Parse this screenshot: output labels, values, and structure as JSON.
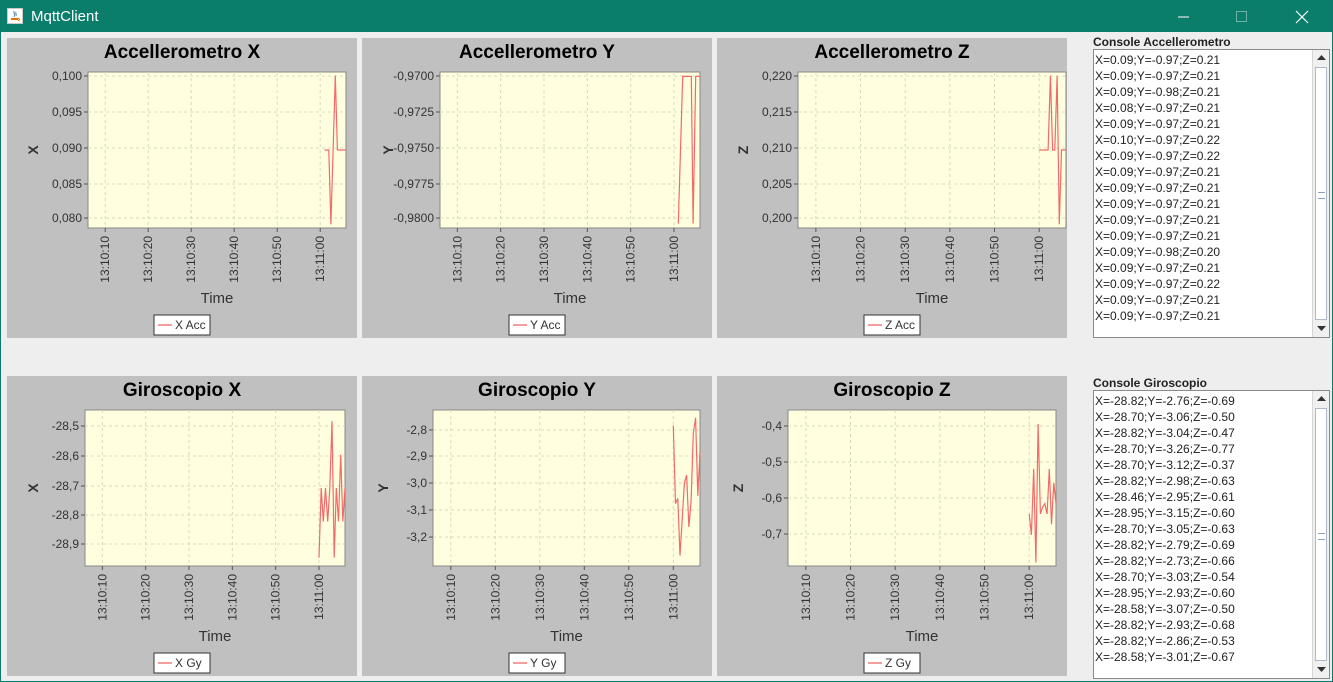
{
  "window": {
    "title": "MqttClient",
    "controls": {
      "minimize": "minimize-icon",
      "maximize": "maximize-icon",
      "close": "close-icon"
    }
  },
  "charts": [
    {
      "title": "Accellerometro X",
      "ylabel": "X",
      "xlabel": "Time",
      "legend": "X Acc",
      "yticks": [
        "0,100",
        "0,095",
        "0,090",
        "0,085",
        "0,080"
      ]
    },
    {
      "title": "Accellerometro Y",
      "ylabel": "Y",
      "xlabel": "Time",
      "legend": "Y Acc",
      "yticks": [
        "-0,9700",
        "-0,9725",
        "-0,9750",
        "-0,9775",
        "-0,9800"
      ]
    },
    {
      "title": "Accellerometro Z",
      "ylabel": "Z",
      "xlabel": "Time",
      "legend": "Z Acc",
      "yticks": [
        "0,220",
        "0,215",
        "0,210",
        "0,205",
        "0,200"
      ]
    },
    {
      "title": "Giroscopio X",
      "ylabel": "X",
      "xlabel": "Time",
      "legend": "X Gy",
      "yticks": [
        "-28,5",
        "-28,6",
        "-28,7",
        "-28,8",
        "-28,9"
      ]
    },
    {
      "title": "Giroscopio Y",
      "ylabel": "Y",
      "xlabel": "Time",
      "legend": "Y Gy",
      "yticks": [
        "-2,8",
        "-2,9",
        "-3,0",
        "-3,1",
        "-3,2"
      ]
    },
    {
      "title": "Giroscopio Z",
      "ylabel": "Z",
      "xlabel": "Time",
      "legend": "Z Gy",
      "yticks": [
        "-0,4",
        "-0,5",
        "-0,6",
        "-0,7"
      ]
    }
  ],
  "xticks": [
    "13:10:10",
    "13:10:20",
    "13:10:30",
    "13:10:40",
    "13:10:50",
    "13:11:00"
  ],
  "colors": {
    "plot_bg": "#ffffe0",
    "series": "#f26a6a",
    "panel": "#c0c0c0",
    "titlebar": "#0b7d6b"
  },
  "chart_data": [
    {
      "type": "line",
      "title": "Accellerometro X",
      "xlabel": "Time",
      "ylabel": "X",
      "x_range": [
        "13:10:06",
        "13:11:06"
      ],
      "ylim": [
        0.0795,
        0.1005
      ],
      "series": [
        {
          "name": "X Acc",
          "x": [
            "13:11:01",
            "13:11:02",
            "13:11:02.5",
            "13:11:03",
            "13:11:03.5",
            "13:11:04",
            "13:11:05",
            "13:11:06"
          ],
          "values": [
            0.09,
            0.09,
            0.08,
            0.09,
            0.1,
            0.09,
            0.09,
            0.09
          ]
        }
      ]
    },
    {
      "type": "line",
      "title": "Accellerometro Y",
      "xlabel": "Time",
      "ylabel": "Y",
      "x_range": [
        "13:10:06",
        "13:11:06"
      ],
      "ylim": [
        -0.9803,
        -0.9697
      ],
      "series": [
        {
          "name": "Y Acc",
          "x": [
            "13:11:01",
            "13:11:02",
            "13:11:02.4",
            "13:11:03",
            "13:11:04",
            "13:11:04.4",
            "13:11:05",
            "13:11:05.4",
            "13:11:06"
          ],
          "values": [
            -0.98,
            -0.97,
            -0.97,
            -0.97,
            -0.97,
            -0.98,
            -0.97,
            -0.97,
            -0.97
          ]
        }
      ]
    },
    {
      "type": "line",
      "title": "Accellerometro Z",
      "xlabel": "Time",
      "ylabel": "Z",
      "x_range": [
        "13:10:06",
        "13:11:06"
      ],
      "ylim": [
        0.1995,
        0.2205
      ],
      "series": [
        {
          "name": "Z Acc",
          "x": [
            "13:11:00",
            "13:11:01",
            "13:11:02",
            "13:11:02.5",
            "13:11:03",
            "13:11:03.5",
            "13:11:04",
            "13:11:04.5",
            "13:11:05",
            "13:11:05.5",
            "13:11:06"
          ],
          "values": [
            0.21,
            0.21,
            0.21,
            0.22,
            0.21,
            0.21,
            0.22,
            0.2,
            0.21,
            0.21,
            0.21
          ]
        }
      ]
    },
    {
      "type": "line",
      "title": "Giroscopio X",
      "xlabel": "Time",
      "ylabel": "X",
      "x_range": [
        "13:10:06",
        "13:11:06"
      ],
      "ylim": [
        -28.98,
        -28.42
      ],
      "series": [
        {
          "name": "X Gy",
          "x": [
            "13:11:00",
            "13:11:00.5",
            "13:11:01",
            "13:11:01.5",
            "13:11:02",
            "13:11:02.5",
            "13:11:03",
            "13:11:03.5",
            "13:11:04",
            "13:11:04.5",
            "13:11:05",
            "13:11:05.5",
            "13:11:06"
          ],
          "values": [
            -28.95,
            -28.7,
            -28.82,
            -28.7,
            -28.82,
            -28.7,
            -28.46,
            -28.95,
            -28.7,
            -28.82,
            -28.58,
            -28.82,
            -28.7
          ]
        }
      ]
    },
    {
      "type": "line",
      "title": "Giroscopio Y",
      "xlabel": "Time",
      "ylabel": "Y",
      "x_range": [
        "13:10:06",
        "13:11:06"
      ],
      "ylim": [
        -3.3,
        -2.7
      ],
      "series": [
        {
          "name": "Y Gy",
          "x": [
            "13:11:00",
            "13:11:00.5",
            "13:11:01",
            "13:11:01.5",
            "13:11:02",
            "13:11:02.5",
            "13:11:03",
            "13:11:03.5",
            "13:11:04",
            "13:11:04.5",
            "13:11:05",
            "13:11:05.5",
            "13:11:06"
          ],
          "values": [
            -2.76,
            -3.06,
            -3.04,
            -3.26,
            -3.12,
            -2.98,
            -2.95,
            -3.15,
            -3.05,
            -2.79,
            -2.73,
            -3.03,
            -2.86
          ]
        }
      ]
    },
    {
      "type": "line",
      "title": "Giroscopio Z",
      "xlabel": "Time",
      "ylabel": "Z",
      "x_range": [
        "13:10:06",
        "13:11:06"
      ],
      "ylim": [
        -0.78,
        -0.33
      ],
      "series": [
        {
          "name": "Z Gy",
          "x": [
            "13:11:00",
            "13:11:00.5",
            "13:11:01",
            "13:11:01.5",
            "13:11:02",
            "13:11:02.5",
            "13:11:03",
            "13:11:03.5",
            "13:11:04",
            "13:11:04.5",
            "13:11:05",
            "13:11:05.5",
            "13:11:06"
          ],
          "values": [
            -0.63,
            -0.69,
            -0.5,
            -0.77,
            -0.37,
            -0.63,
            -0.61,
            -0.6,
            -0.63,
            -0.5,
            -0.66,
            -0.54,
            -0.6
          ]
        }
      ]
    }
  ],
  "consoles": {
    "accel": {
      "label": "Console Accellerometro",
      "lines": [
        "X=0.09;Y=-0.97;Z=0.21",
        "X=0.09;Y=-0.97;Z=0.21",
        "X=0.09;Y=-0.98;Z=0.21",
        "X=0.08;Y=-0.97;Z=0.21",
        "X=0.09;Y=-0.97;Z=0.21",
        "X=0.10;Y=-0.97;Z=0.22",
        "X=0.09;Y=-0.97;Z=0.22",
        "X=0.09;Y=-0.97;Z=0.21",
        "X=0.09;Y=-0.97;Z=0.21",
        "X=0.09;Y=-0.97;Z=0.21",
        "X=0.09;Y=-0.97;Z=0.21",
        "X=0.09;Y=-0.97;Z=0.21",
        "X=0.09;Y=-0.98;Z=0.20",
        "X=0.09;Y=-0.97;Z=0.21",
        "X=0.09;Y=-0.97;Z=0.22",
        "X=0.09;Y=-0.97;Z=0.21",
        "X=0.09;Y=-0.97;Z=0.21"
      ]
    },
    "gyro": {
      "label": "Console Giroscopio",
      "lines": [
        "X=-28.82;Y=-2.76;Z=-0.69",
        "X=-28.70;Y=-3.06;Z=-0.50",
        "X=-28.82;Y=-3.04;Z=-0.47",
        "X=-28.70;Y=-3.26;Z=-0.77",
        "X=-28.70;Y=-3.12;Z=-0.37",
        "X=-28.82;Y=-2.98;Z=-0.63",
        "X=-28.46;Y=-2.95;Z=-0.61",
        "X=-28.95;Y=-3.15;Z=-0.60",
        "X=-28.70;Y=-3.05;Z=-0.63",
        "X=-28.82;Y=-2.79;Z=-0.69",
        "X=-28.82;Y=-2.73;Z=-0.66",
        "X=-28.70;Y=-3.03;Z=-0.54",
        "X=-28.95;Y=-2.93;Z=-0.60",
        "X=-28.58;Y=-3.07;Z=-0.50",
        "X=-28.82;Y=-2.93;Z=-0.68",
        "X=-28.82;Y=-2.86;Z=-0.53",
        "X=-28.58;Y=-3.01;Z=-0.67"
      ]
    }
  }
}
